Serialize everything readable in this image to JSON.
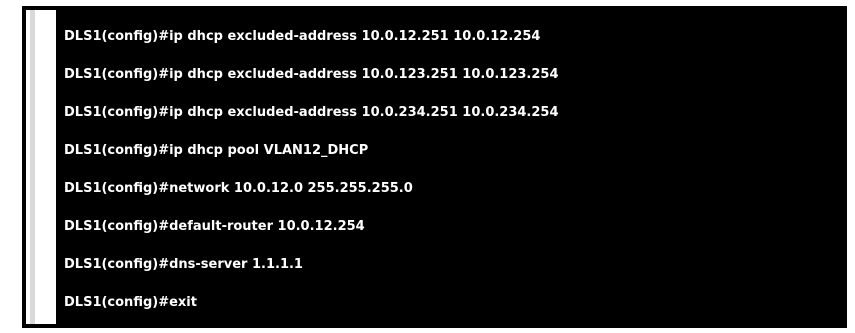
{
  "terminal": {
    "lines": [
      "DLS1(config)#ip dhcp excluded-address 10.0.12.251 10.0.12.254",
      "DLS1(config)#ip dhcp excluded-address 10.0.123.251 10.0.123.254",
      "DLS1(config)#ip dhcp excluded-address 10.0.234.251 10.0.234.254",
      "DLS1(config)#ip dhcp pool VLAN12_DHCP",
      "DLS1(config)#network 10.0.12.0 255.255.255.0",
      "DLS1(config)#default-router 10.0.12.254",
      "DLS1(config)#dns-server 1.1.1.1",
      "DLS1(config)#exit"
    ],
    "background_color": "#000000",
    "text_color": "#ffffff"
  }
}
